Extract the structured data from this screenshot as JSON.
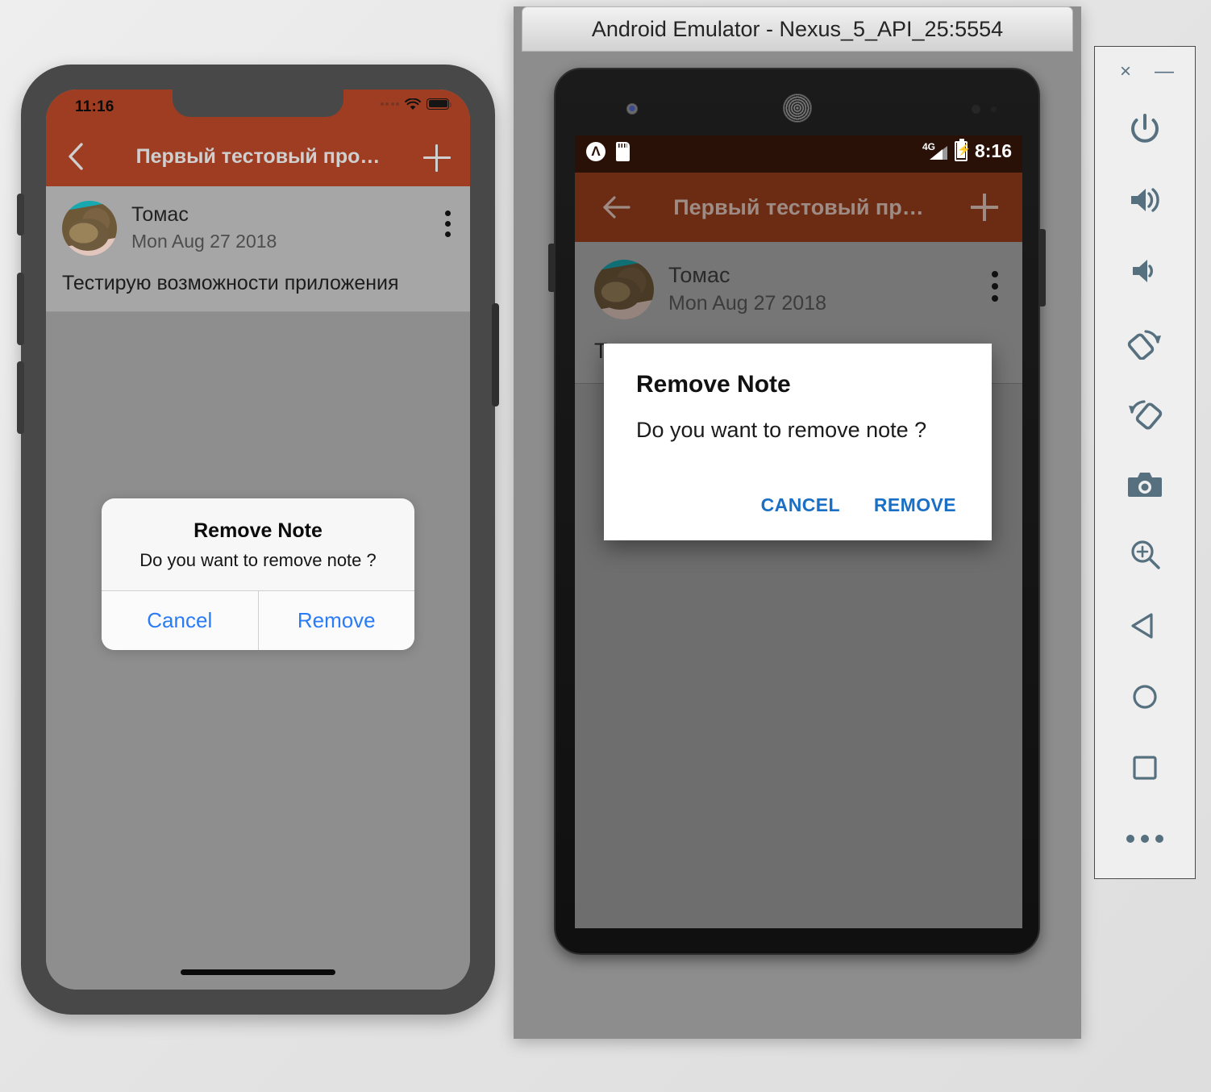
{
  "ios": {
    "status": {
      "time": "11:16",
      "wifi_icon": "wifi-icon",
      "battery_icon": "battery-icon"
    },
    "navbar": {
      "title": "Первый тестовый про…",
      "back_icon": "chevron-left-icon",
      "add_icon": "plus-icon"
    },
    "note": {
      "author": "Томас",
      "date": "Mon Aug 27 2018",
      "text": "Тестирую возможности приложения",
      "avatar_icon": "cat-avatar",
      "overflow_icon": "kebab-menu-icon"
    },
    "alert": {
      "title": "Remove Note",
      "message": "Do you want to remove note ?",
      "cancel_label": "Cancel",
      "remove_label": "Remove",
      "tint_color": "#2a7bf6"
    }
  },
  "android": {
    "window_title": "Android Emulator - Nexus_5_API_25:5554",
    "status": {
      "clock": "8:16",
      "app_icon": "app-badge-icon",
      "sd_icon": "sd-card-icon",
      "signal_label": "4G",
      "signal_icon": "signal-bars-icon",
      "battery_icon": "battery-charging-icon"
    },
    "toolbar": {
      "title": "Первый тестовый пр…",
      "back_icon": "arrow-left-icon",
      "add_icon": "plus-icon"
    },
    "note": {
      "author": "Томас",
      "date": "Mon Aug 27 2018",
      "text": "Тестирую возможности приложения",
      "avatar_icon": "cat-avatar",
      "overflow_icon": "kebab-menu-icon"
    },
    "dialog": {
      "title": "Remove Note",
      "message": "Do you want to remove note ?",
      "cancel_label": "CANCEL",
      "remove_label": "REMOVE",
      "accent_color": "#1b6fc4"
    },
    "navbar": {
      "back_icon": "nav-back-icon",
      "home_icon": "nav-home-icon",
      "recents_icon": "nav-recents-icon"
    }
  },
  "emulator_toolbar": {
    "close_glyph": "×",
    "minimize_glyph": "—",
    "buttons": [
      "power-icon",
      "volume-up-icon",
      "volume-down-icon",
      "rotate-left-icon",
      "rotate-right-icon",
      "screenshot-camera-icon",
      "zoom-in-icon",
      "nav-back-icon",
      "nav-home-icon",
      "nav-recents-icon",
      "more-options-icon"
    ]
  },
  "theme": {
    "ios_header": "#9e3d22",
    "android_header": "#6c2c14",
    "android_statusbar": "#2a1108",
    "ios_tint": "#2a7bf6",
    "android_accent": "#1b6fc4"
  }
}
